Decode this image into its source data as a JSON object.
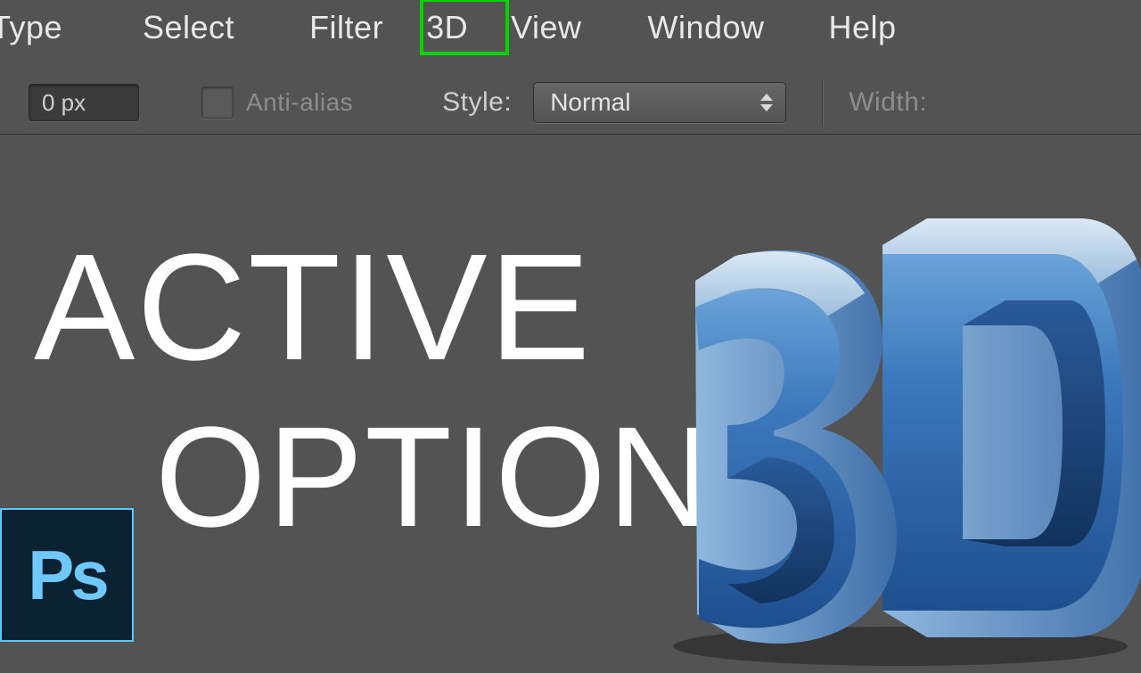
{
  "menu": {
    "type": "Type",
    "select": "Select",
    "filter": "Filter",
    "threeD": "3D",
    "view": "View",
    "window": "Window",
    "help": "Help"
  },
  "options": {
    "px_value": "0 px",
    "antialias_label": "Anti-alias",
    "antialias_checked": false,
    "style_label": "Style:",
    "style_value": "Normal",
    "width_label": "Width:"
  },
  "overlay": {
    "line1": "ACTIVE",
    "line2": "OPTION"
  },
  "ps_logo": "Ps",
  "highlight_color": "#00d400"
}
